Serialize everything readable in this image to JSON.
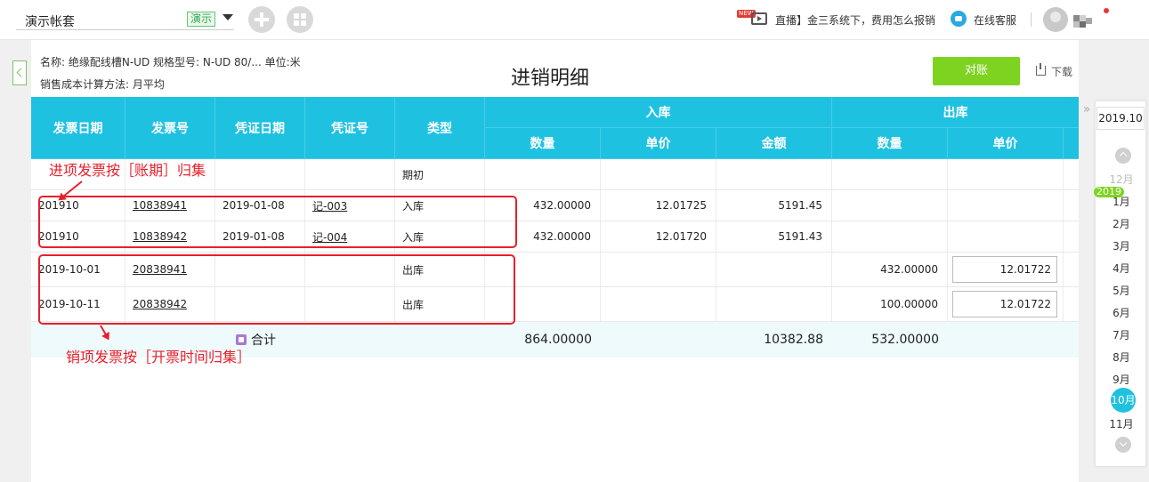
{
  "topbar": {
    "account_name": "演示帐套",
    "account_badge": "演示",
    "live_new": "NEW",
    "live_text": "直播】金三系统下，费用怎么报销",
    "service_text": "在线客服"
  },
  "info": {
    "line1": "名称: 绝缘配线槽N-UD    规格型号: N-UD 80/...    单位:米",
    "line2": "销售成本计算方法: 月平均"
  },
  "page_title": "进销明细",
  "actions": {
    "reconcile": "对账",
    "download": "下载"
  },
  "table": {
    "headers": {
      "invoice_date": "发票日期",
      "invoice_no": "发票号",
      "voucher_date": "凭证日期",
      "voucher_no": "凭证号",
      "type": "类型",
      "inbound": "入库",
      "outbound": "出库",
      "qty": "数量",
      "price": "单价",
      "amount": "金额",
      "out_qty": "数量",
      "out_price": "单价"
    },
    "opening": {
      "type": "期初"
    },
    "rows": [
      {
        "invoice_date": "201910",
        "invoice_no": "10838941",
        "voucher_date": "2019-01-08",
        "voucher_no": "记-003",
        "type": "入库",
        "in_qty": "432.00000",
        "in_price": "12.01725",
        "in_amount": "5191.45",
        "out_qty": "",
        "out_price": ""
      },
      {
        "invoice_date": "201910",
        "invoice_no": "10838942",
        "voucher_date": "2019-01-08",
        "voucher_no": "记-004",
        "type": "入库",
        "in_qty": "432.00000",
        "in_price": "12.01720",
        "in_amount": "5191.43",
        "out_qty": "",
        "out_price": ""
      },
      {
        "invoice_date": "2019-10-01",
        "invoice_no": "20838941",
        "voucher_date": "",
        "voucher_no": "",
        "type": "出库",
        "in_qty": "",
        "in_price": "",
        "in_amount": "",
        "out_qty": "432.00000",
        "out_price": "12.01722"
      },
      {
        "invoice_date": "2019-10-11",
        "invoice_no": "20838942",
        "voucher_date": "",
        "voucher_no": "",
        "type": "出库",
        "in_qty": "",
        "in_price": "",
        "in_amount": "",
        "out_qty": "100.00000",
        "out_price": "12.01722"
      }
    ],
    "total": {
      "label": "合计",
      "in_qty": "864.00000",
      "in_amount": "10382.88",
      "out_qty": "532.00000"
    }
  },
  "annotations": {
    "purchase_note": "进项发票按［账期］归集",
    "sales_note": "销项发票按［开票时间归集］"
  },
  "picker": {
    "current": "2019.10",
    "prev_month": "12月",
    "year_badge": "2019",
    "months": [
      "1月",
      "2月",
      "3月",
      "4月",
      "5月",
      "6月",
      "7月",
      "8月",
      "9月"
    ],
    "selected": "10月",
    "next_month": "11月"
  },
  "colors": {
    "header": "#1fc1e1",
    "accent_green": "#7ed321",
    "annotation_red": "#e8202a"
  }
}
